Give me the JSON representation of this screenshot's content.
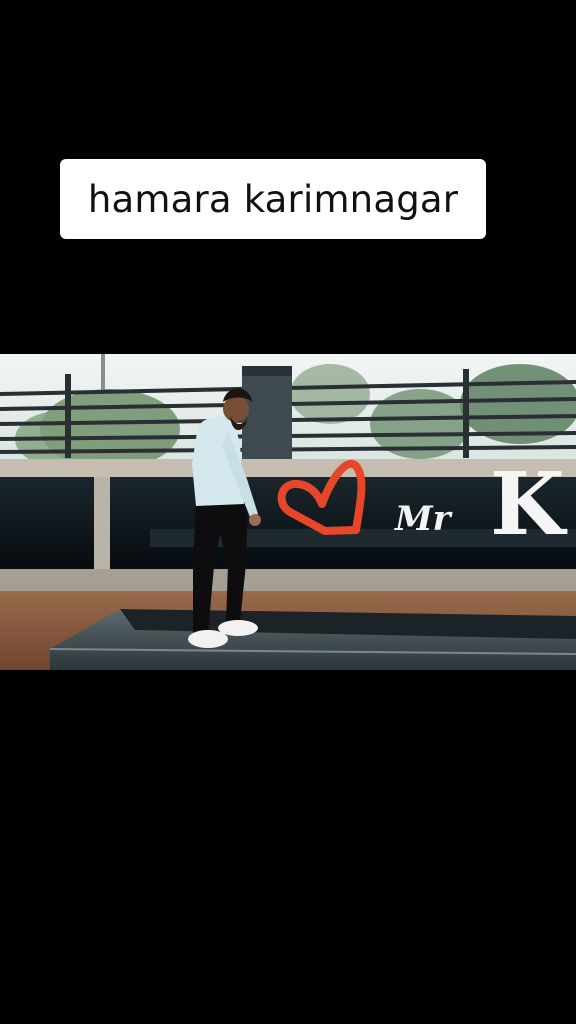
{
  "caption": {
    "text": "hamara karimnagar"
  },
  "photo": {
    "sign": {
      "script_text": "Mr",
      "letter": "K"
    },
    "colors": {
      "heart": "#e8462a",
      "sky": "#e9f0ee",
      "wall": "#0c1418",
      "stone": "#b9b3a8",
      "ground": "#8a5a3e"
    }
  }
}
